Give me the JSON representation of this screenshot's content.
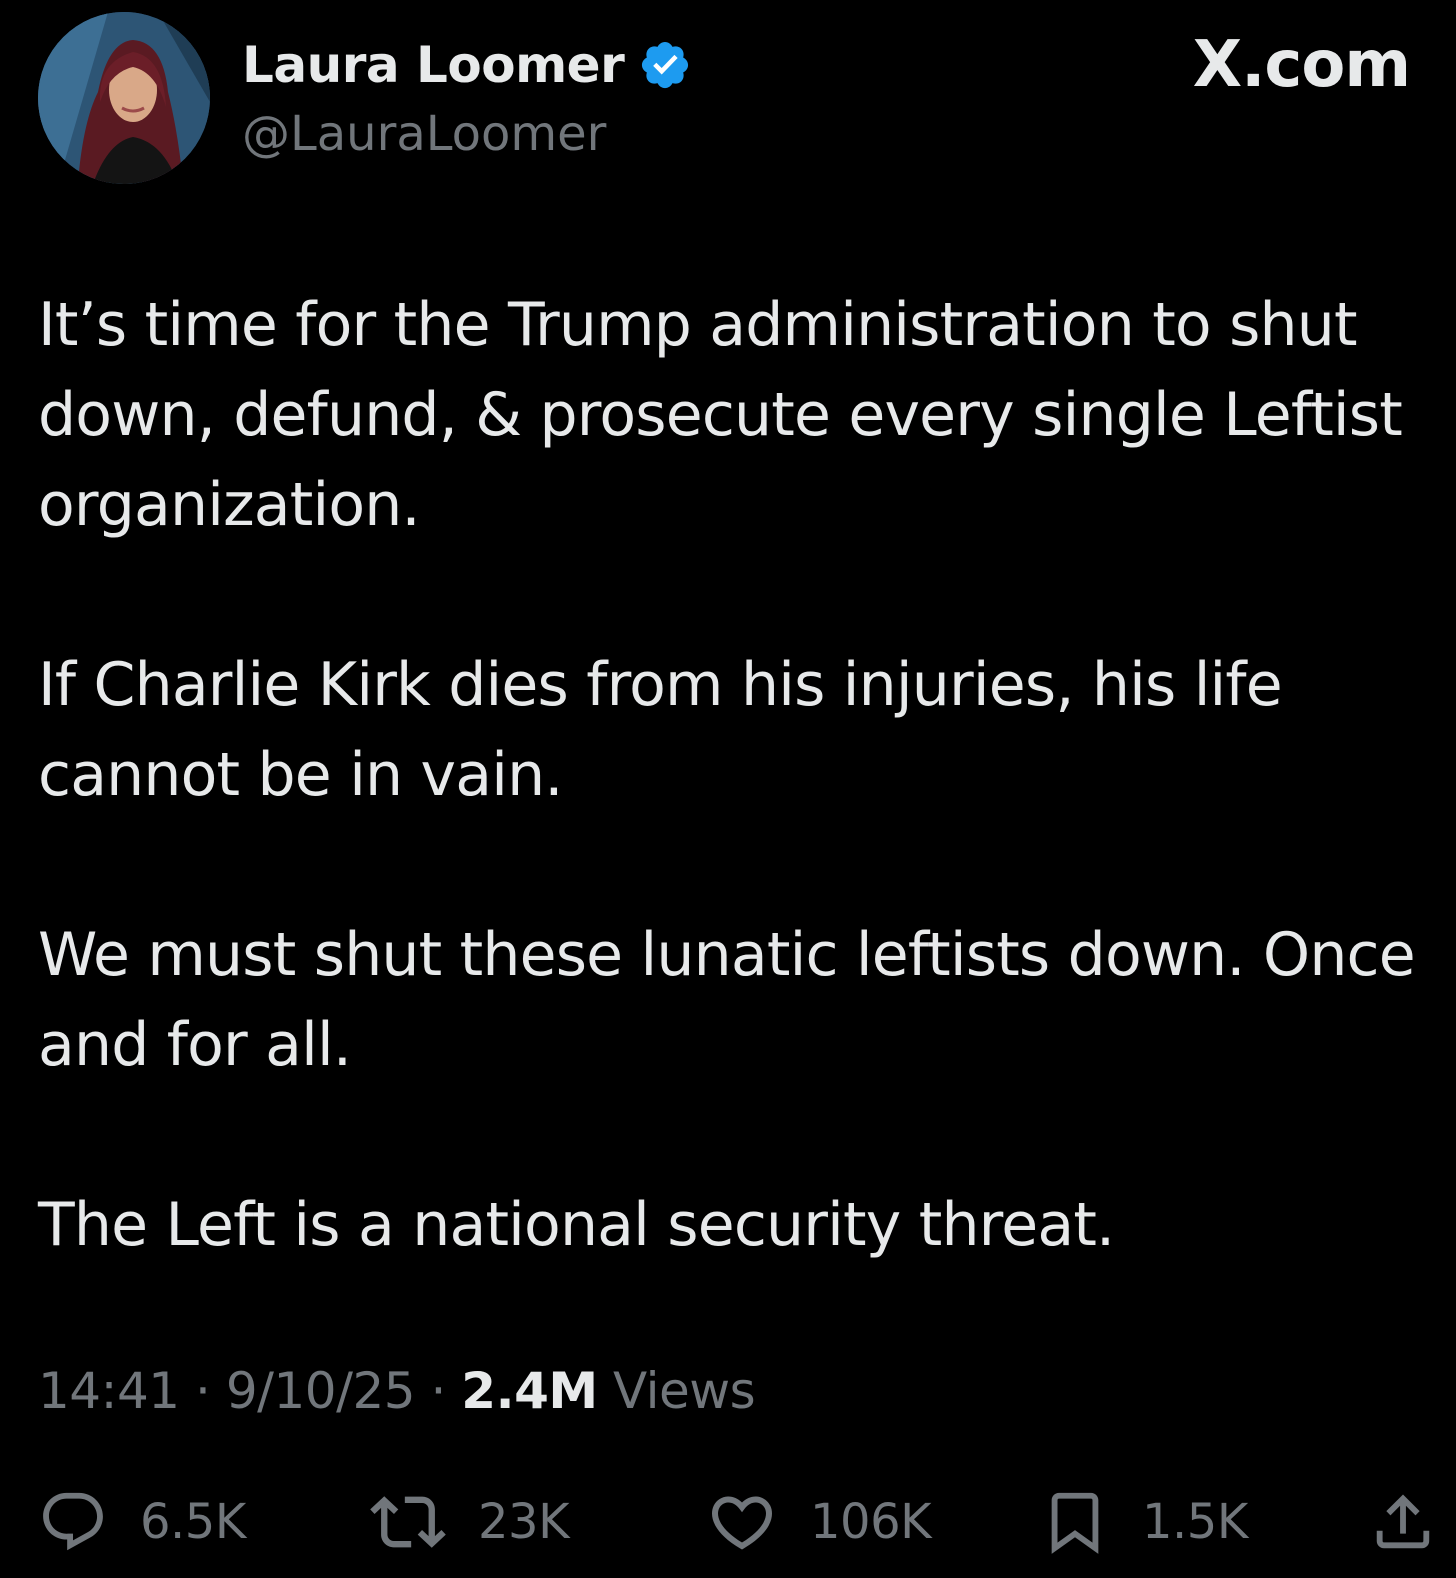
{
  "header": {
    "display_name": "Laura Loomer",
    "handle": "@LauraLoomer",
    "brand": "X.com",
    "verified_color": "#1d9bf0"
  },
  "tweet": {
    "paragraphs": [
      "It’s time for the Trump administration to shut down, defund, & prosecute every single Leftist organization.",
      "If Charlie Kirk dies from his injuries, his life cannot be in vain.",
      "We must shut these lunatic leftists down. Once and for all.",
      "The Left is a national security threat."
    ]
  },
  "meta": {
    "time": "14:41",
    "separator": "·",
    "date": "9/10/25",
    "views_count": "2.4M",
    "views_label": "Views"
  },
  "actions": {
    "replies": {
      "icon": "reply-icon",
      "count": "6.5K"
    },
    "reposts": {
      "icon": "repost-icon",
      "count": "23K"
    },
    "likes": {
      "icon": "heart-icon",
      "count": "106K"
    },
    "bookmarks": {
      "icon": "bookmark-icon",
      "count": "1.5K"
    },
    "share": {
      "icon": "share-icon"
    }
  },
  "colors": {
    "background": "#000000",
    "text_primary": "#e7e9ea",
    "text_secondary": "#71767b"
  }
}
